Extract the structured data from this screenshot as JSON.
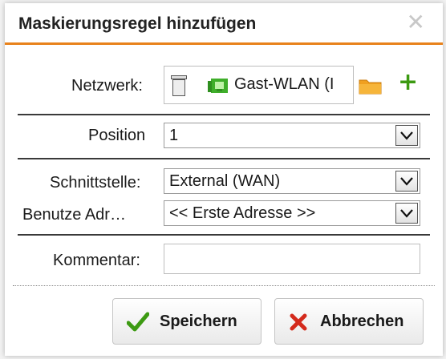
{
  "dialog": {
    "title": "Maskierungsregel hinzufügen",
    "close_glyph": "✕"
  },
  "form": {
    "network_label": "Netzwerk:",
    "network_value": "Gast-WLAN (I",
    "position_label": "Position",
    "position_value": "1",
    "interface_label": "Schnittstelle:",
    "interface_value": "External (WAN)",
    "address_label": "Benutze Adr…",
    "address_value": "<< Erste Adresse >>",
    "comment_label": "Kommentar:",
    "comment_value": ""
  },
  "buttons": {
    "save_label": "Speichern",
    "cancel_label": "Abbrechen"
  },
  "icons": {
    "trash": "trash-icon",
    "network": "network-icon",
    "folder": "folder-icon",
    "add": "plus-icon",
    "save": "checkmark-icon",
    "cancel": "cross-icon"
  },
  "colors": {
    "accent": "#e8821c",
    "network_icon": "#3fae2a",
    "plus": "#3c9a12",
    "check": "#3c9a12",
    "cross": "#d42a1c",
    "folder": "#f0a020"
  }
}
